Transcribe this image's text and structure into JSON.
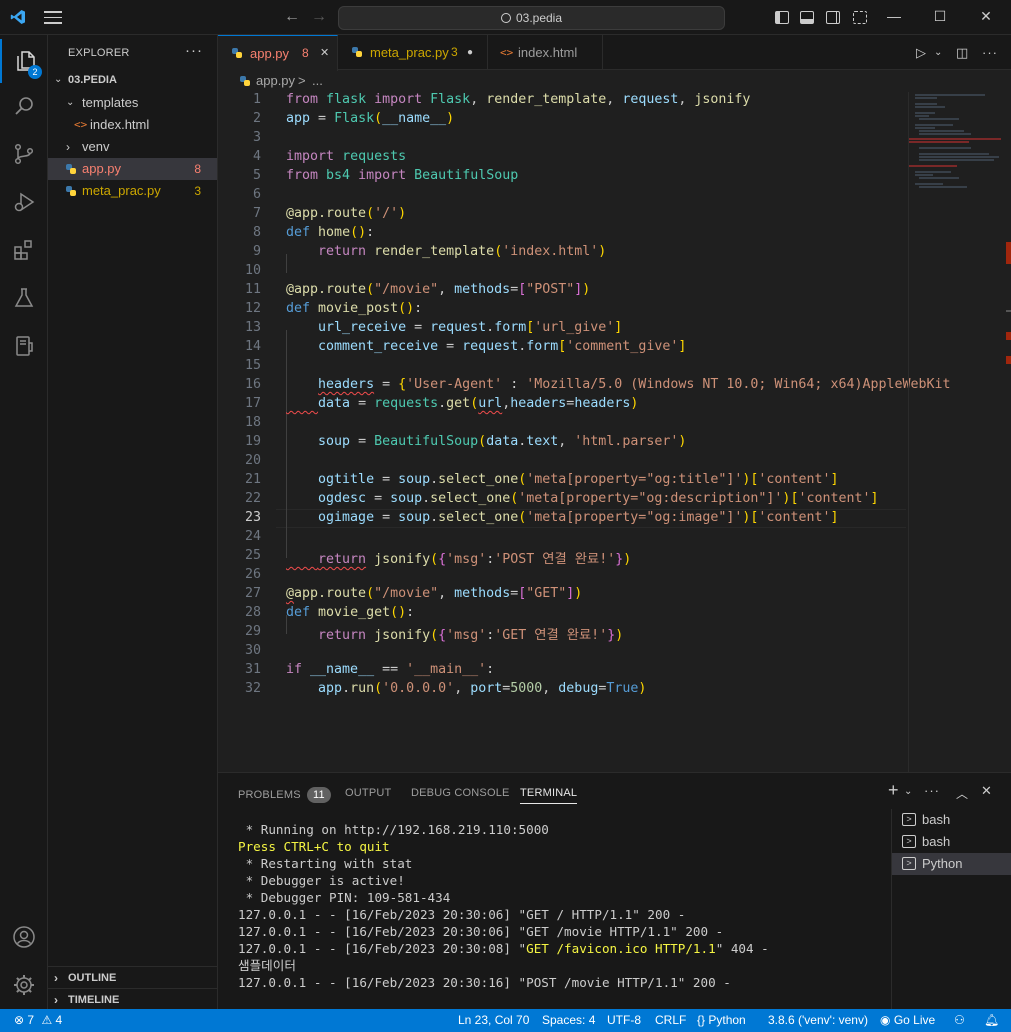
{
  "titlebar": {
    "search_text": "03.pedia"
  },
  "activity": {
    "explorer_badge": "2"
  },
  "sidebar": {
    "title": "EXPLORER",
    "more": "···",
    "folder": "03.PEDIA",
    "items": [
      {
        "label": "templates"
      },
      {
        "label": "index.html"
      },
      {
        "label": "venv"
      },
      {
        "label": "app.py",
        "count": "8"
      },
      {
        "label": "meta_prac.py",
        "count": "3"
      }
    ],
    "outline": "OUTLINE",
    "timeline": "TIMELINE"
  },
  "tabs": [
    {
      "label": "app.py",
      "count": "8"
    },
    {
      "label": "meta_prac.py",
      "count": "3"
    },
    {
      "label": "index.html"
    }
  ],
  "breadcrumb": {
    "file": "app.py",
    "sep": ">",
    "more": "..."
  },
  "editor": {
    "line_numbers": [
      "1",
      "2",
      "3",
      "4",
      "5",
      "6",
      "7",
      "8",
      "9",
      "10",
      "11",
      "12",
      "13",
      "14",
      "15",
      "16",
      "17",
      "18",
      "19",
      "20",
      "21",
      "22",
      "23",
      "24",
      "25",
      "26",
      "27",
      "28",
      "29",
      "30",
      "31",
      "32"
    ],
    "current_line": 23
  },
  "panel": {
    "tabs": {
      "problems": "PROBLEMS",
      "problems_count": "11",
      "output": "OUTPUT",
      "debug": "DEBUG CONSOLE",
      "terminal": "TERMINAL"
    },
    "terminal_lines": [
      " * Running on http://192.168.219.110:5000",
      "Press CTRL+C to quit",
      " * Restarting with stat",
      " * Debugger is active!",
      " * Debugger PIN: 109-581-434",
      "127.0.0.1 - - [16/Feb/2023 20:30:06] \"GET / HTTP/1.1\" 200 -",
      "127.0.0.1 - - [16/Feb/2023 20:30:06] \"GET /movie HTTP/1.1\" 200 -",
      "127.0.0.1 - - [16/Feb/2023 20:30:08] \"GET /favicon.ico HTTP/1.1\" 404 -",
      "샘플데이터",
      "127.0.0.1 - - [16/Feb/2023 20:30:16] \"POST /movie HTTP/1.1\" 200 -"
    ],
    "terminals": [
      "bash",
      "bash",
      "Python"
    ]
  },
  "status": {
    "errors": "7",
    "warnings": "4",
    "position": "Ln 23, Col 70",
    "spaces": "Spaces: 4",
    "encoding": "UTF-8",
    "eol": "CRLF",
    "language": "Python",
    "interpreter": "3.8.6 ('venv': venv)",
    "golive": "Go Live"
  },
  "colors": {
    "accent": "#0078d4",
    "error": "#f14c4c",
    "warning": "#cca700",
    "modified": "#e2c08d"
  }
}
